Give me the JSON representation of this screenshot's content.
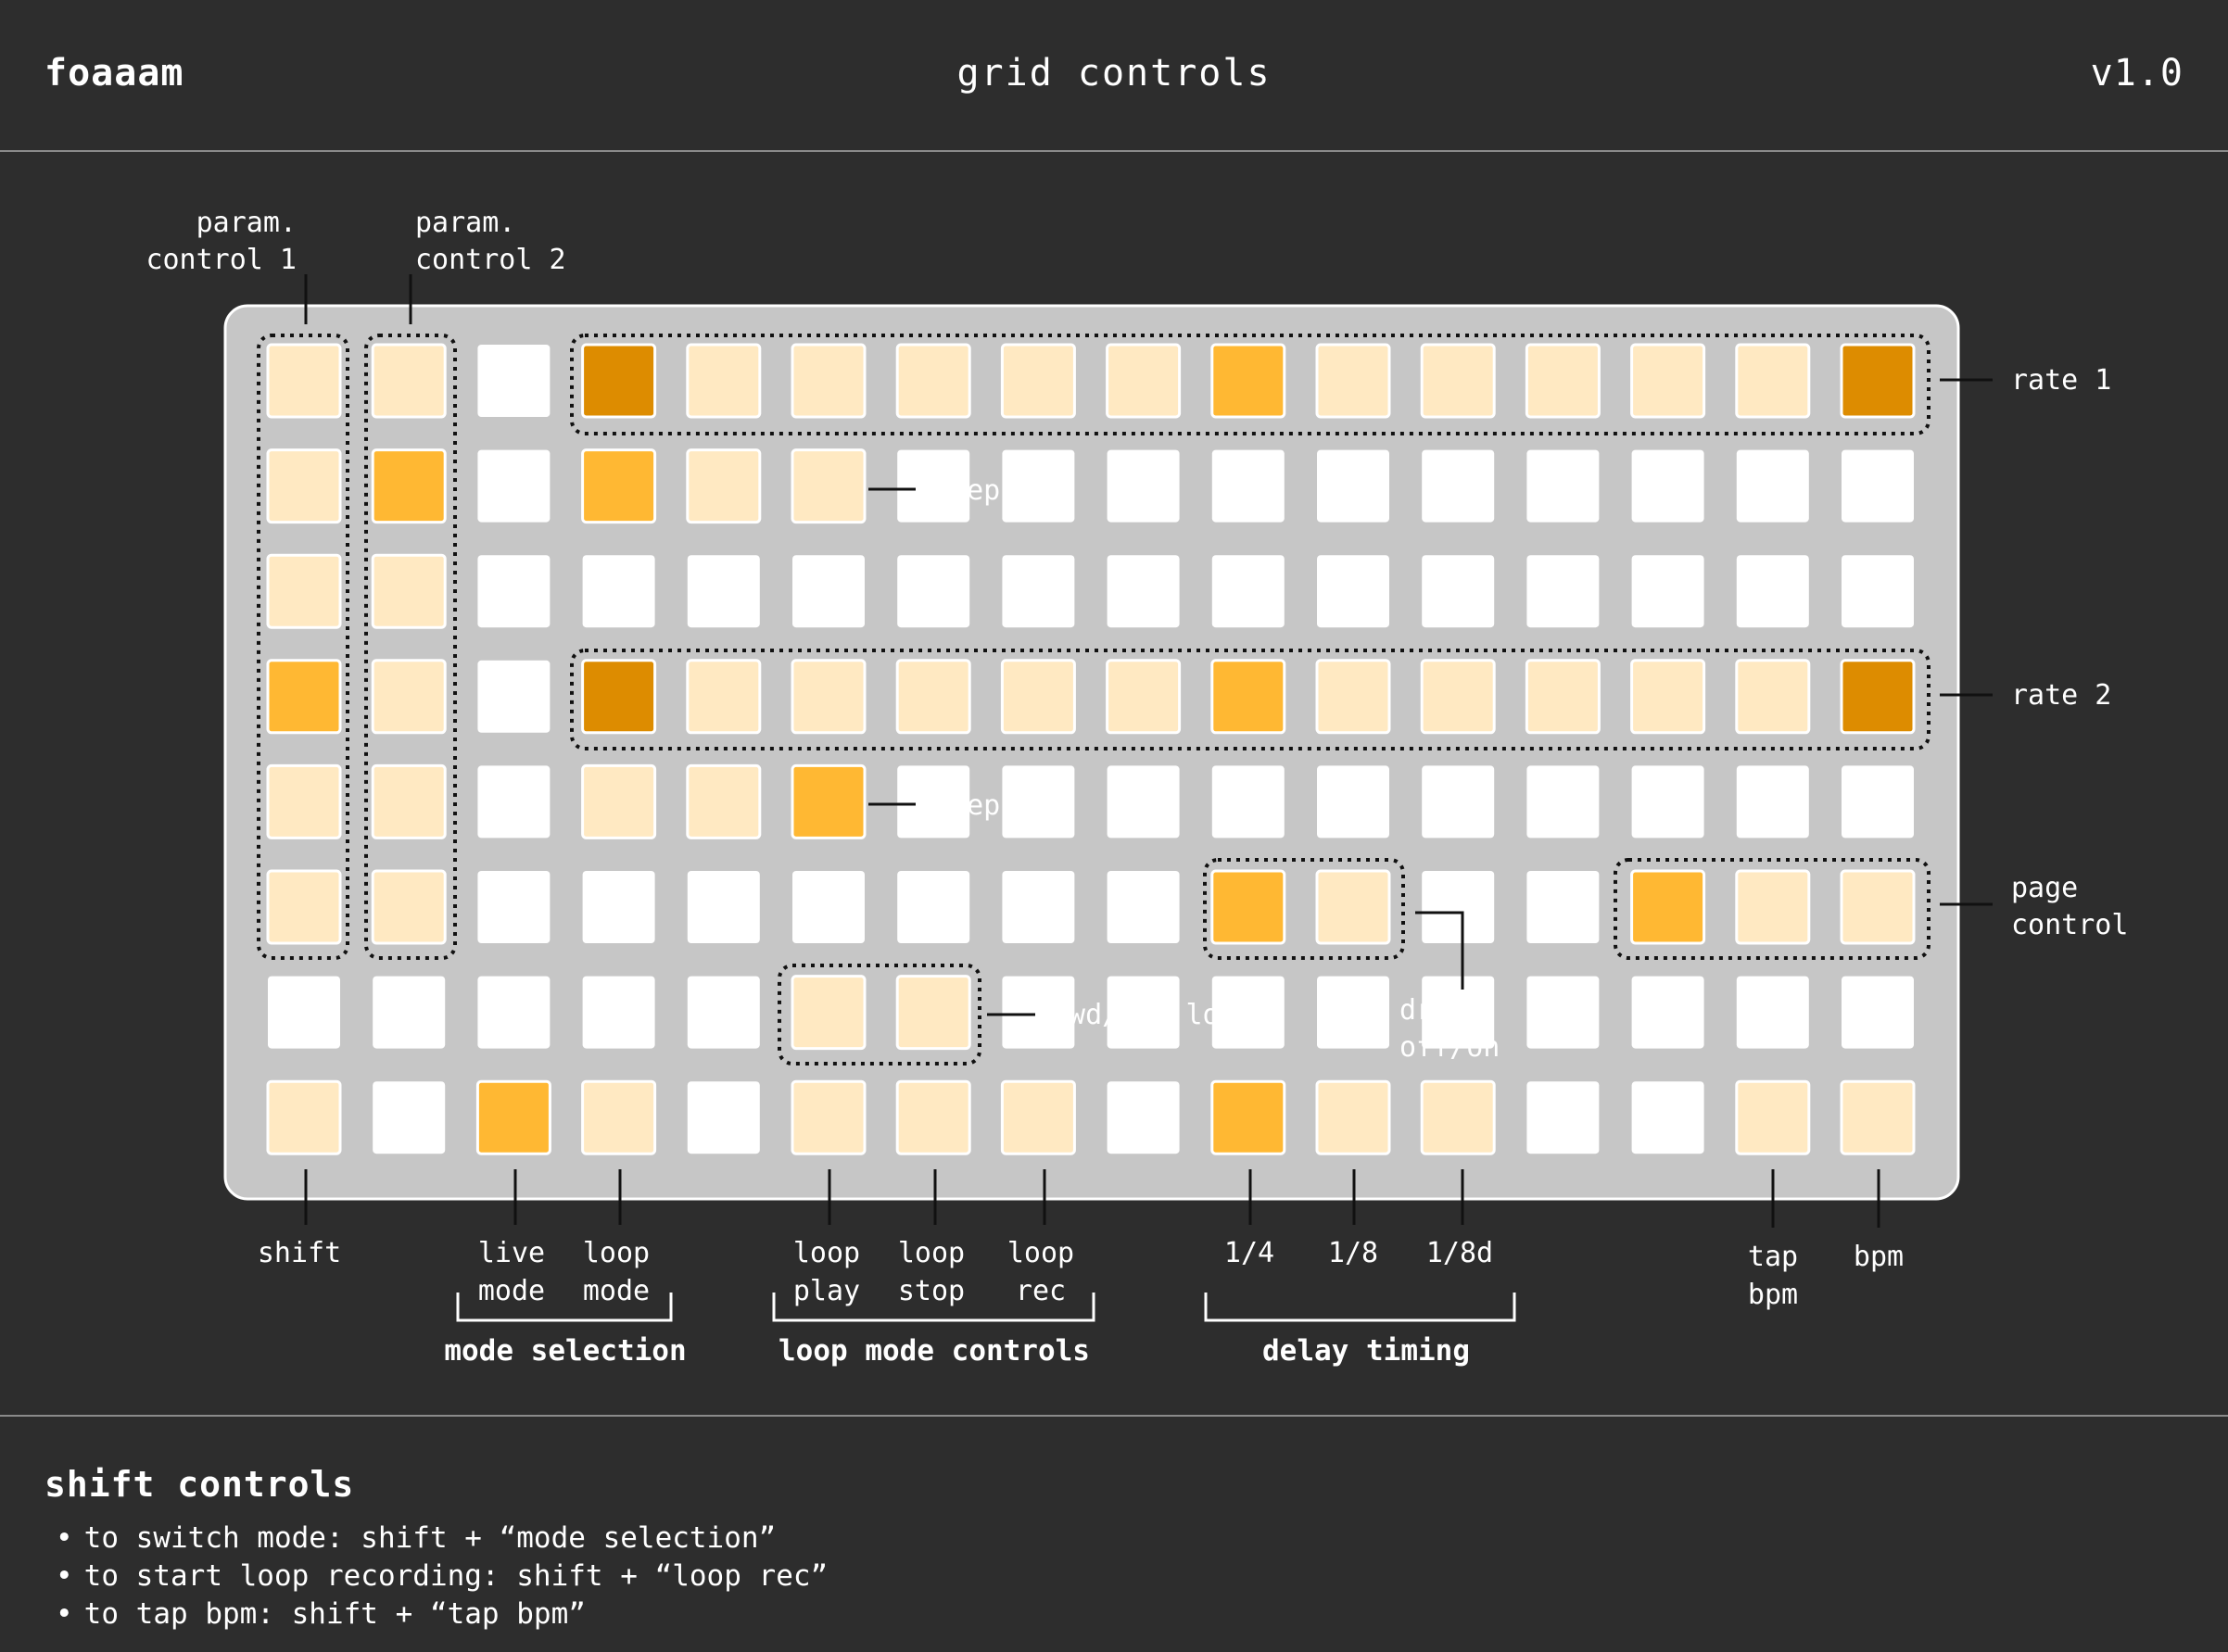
{
  "header": {
    "brand": "foaaam",
    "title": "grid controls",
    "version": "v1.0"
  },
  "colors": {
    "off": "#ffffff",
    "light": "#ffe9c2",
    "mid": "#ffb833",
    "dark": "#dd8c00",
    "panel": "#c6c6c6",
    "background": "#2d2d2d"
  },
  "grid": {
    "cols": 16,
    "rows": 8,
    "cells": [
      [
        "light",
        "light",
        "off",
        "dark",
        "light",
        "light",
        "light",
        "light",
        "light",
        "mid",
        "light",
        "light",
        "light",
        "light",
        "light",
        "dark"
      ],
      [
        "light",
        "mid",
        "off",
        "mid",
        "light",
        "light",
        "off",
        "off",
        "off",
        "off",
        "off",
        "off",
        "off",
        "off",
        "off",
        "off"
      ],
      [
        "light",
        "light",
        "off",
        "off",
        "off",
        "off",
        "off",
        "off",
        "off",
        "off",
        "off",
        "off",
        "off",
        "off",
        "off",
        "off"
      ],
      [
        "mid",
        "light",
        "off",
        "dark",
        "light",
        "light",
        "light",
        "light",
        "light",
        "mid",
        "light",
        "light",
        "light",
        "light",
        "light",
        "dark"
      ],
      [
        "light",
        "light",
        "off",
        "light",
        "light",
        "mid",
        "off",
        "off",
        "off",
        "off",
        "off",
        "off",
        "off",
        "off",
        "off",
        "off"
      ],
      [
        "light",
        "light",
        "off",
        "off",
        "off",
        "off",
        "off",
        "off",
        "off",
        "mid",
        "light",
        "off",
        "off",
        "mid",
        "light",
        "light"
      ],
      [
        "off",
        "off",
        "off",
        "off",
        "off",
        "light",
        "light",
        "off",
        "off",
        "off",
        "off",
        "off",
        "off",
        "off",
        "off",
        "off"
      ],
      [
        "light",
        "off",
        "mid",
        "light",
        "off",
        "light",
        "light",
        "light",
        "off",
        "mid",
        "light",
        "light",
        "off",
        "off",
        "light",
        "light"
      ]
    ]
  },
  "labels": {
    "param1": [
      "param.",
      "control 1"
    ],
    "param2": [
      "param.",
      "control 2"
    ],
    "rate1": "rate 1",
    "rate2": "rate 2",
    "step1": "step 1",
    "step2": "step 2",
    "page_control": [
      "page",
      "control"
    ],
    "fwd_bwd": "fwd/bwd loop",
    "dry": [
      "dry",
      "off/on"
    ],
    "shift": "shift",
    "live_mode": [
      "live",
      "mode"
    ],
    "loop_mode": [
      "loop",
      "mode"
    ],
    "loop_play": [
      "loop",
      "play"
    ],
    "loop_stop": [
      "loop",
      "stop"
    ],
    "loop_rec": [
      "loop",
      "rec"
    ],
    "quarter": "1/4",
    "eighth": "1/8",
    "eighth_dotted": "1/8d",
    "tap_bpm": [
      "tap",
      "bpm"
    ],
    "bpm": "bpm"
  },
  "groups": {
    "mode_selection": "mode selection",
    "loop_mode_controls": "loop mode controls",
    "delay_timing": "delay timing"
  },
  "shift_controls": {
    "title": "shift controls",
    "items": [
      "to switch mode: shift + “mode selection”",
      "to start loop recording: shift + “loop rec”",
      "to tap bpm: shift + “tap bpm”"
    ]
  }
}
